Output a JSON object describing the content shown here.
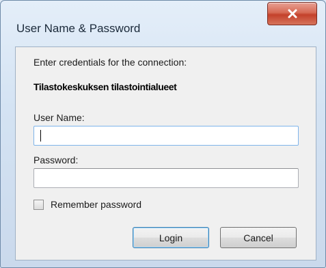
{
  "window": {
    "title": "User Name & Password"
  },
  "dialog": {
    "prompt": "Enter credentials for the connection:",
    "connection_name": "Tilastokeskuksen tilastointialueet",
    "username_label": "User Name:",
    "username_value": "",
    "password_label": "Password:",
    "password_value": "",
    "remember_label": "Remember password",
    "remember_checked": false,
    "login_label": "Login",
    "cancel_label": "Cancel"
  },
  "colors": {
    "close_button": "#c4412b",
    "focus_border": "#3c7fb1"
  },
  "icons": {
    "close": "close-icon",
    "checkbox": "checkbox-icon"
  }
}
